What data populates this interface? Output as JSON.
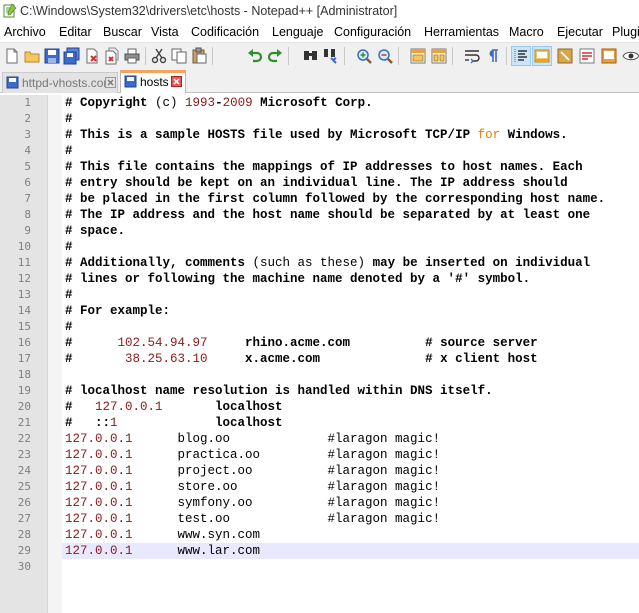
{
  "window": {
    "title": "C:\\Windows\\System32\\drivers\\etc\\hosts - Notepad++ [Administrator]"
  },
  "menu": [
    "Archivo",
    "Editar",
    "Buscar",
    "Vista",
    "Codificación",
    "Lenguaje",
    "Configuración",
    "Herramientas",
    "Macro",
    "Ejecutar",
    "Plugi"
  ],
  "tabs": [
    {
      "label": "httpd-vhosts.conf",
      "active": false
    },
    {
      "label": "hosts",
      "active": true
    }
  ],
  "colors": {
    "tab_accent": "#f5a25d",
    "ip_color": "#8a1b1b",
    "keyword_color": "#e08000",
    "current_line": "#e8e8ff"
  },
  "editor": {
    "current_line": 29,
    "line_numbers": [
      "1",
      "2",
      "3",
      "4",
      "5",
      "6",
      "7",
      "8",
      "9",
      "10",
      "11",
      "12",
      "13",
      "14",
      "15",
      "16",
      "17",
      "18",
      "19",
      "20",
      "21",
      "22",
      "23",
      "24",
      "25",
      "26",
      "27",
      "28",
      "29",
      "30"
    ],
    "lines": [
      "# Copyright (c) 1993-2009 Microsoft Corp.",
      "#",
      "# This is a sample HOSTS file used by Microsoft TCP/IP for Windows.",
      "#",
      "# This file contains the mappings of IP addresses to host names. Each",
      "# entry should be kept on an individual line. The IP address should",
      "# be placed in the first column followed by the corresponding host name.",
      "# The IP address and the host name should be separated by at least one",
      "# space.",
      "#",
      "# Additionally, comments (such as these) may be inserted on individual",
      "# lines or following the machine name denoted by a '#' symbol.",
      "#",
      "# For example:",
      "#",
      "#      102.54.94.97     rhino.acme.com          # source server",
      "#       38.25.63.10     x.acme.com              # x client host",
      "",
      "# localhost name resolution is handled within DNS itself.",
      "#   127.0.0.1       localhost",
      "#   ::1             localhost",
      "127.0.0.1      blog.oo             #laragon magic!",
      "127.0.0.1      practica.oo         #laragon magic!",
      "127.0.0.1      project.oo          #laragon magic!",
      "127.0.0.1      store.oo            #laragon magic!",
      "127.0.0.1      symfony.oo          #laragon magic!",
      "127.0.0.1      test.oo             #laragon magic!",
      "127.0.0.1      www.syn.com",
      "127.0.0.1      www.lar.com",
      ""
    ]
  },
  "toolbar": {
    "icons": [
      "new-file-icon",
      "open-file-icon",
      "save-icon",
      "save-all-icon",
      "close-icon",
      "close-all-icon",
      "print-icon",
      "cut-icon",
      "copy-icon",
      "paste-icon",
      "undo-icon",
      "redo-icon",
      "find-icon",
      "replace-icon",
      "zoom-in-icon",
      "zoom-out-icon",
      "sync-vertical-icon",
      "sync-horizontal-icon",
      "word-wrap-icon",
      "show-all-chars-icon",
      "indent-guide-icon",
      "doc-map-icon",
      "function-list-icon",
      "folder-workspace-icon",
      "monitoring-icon"
    ]
  }
}
